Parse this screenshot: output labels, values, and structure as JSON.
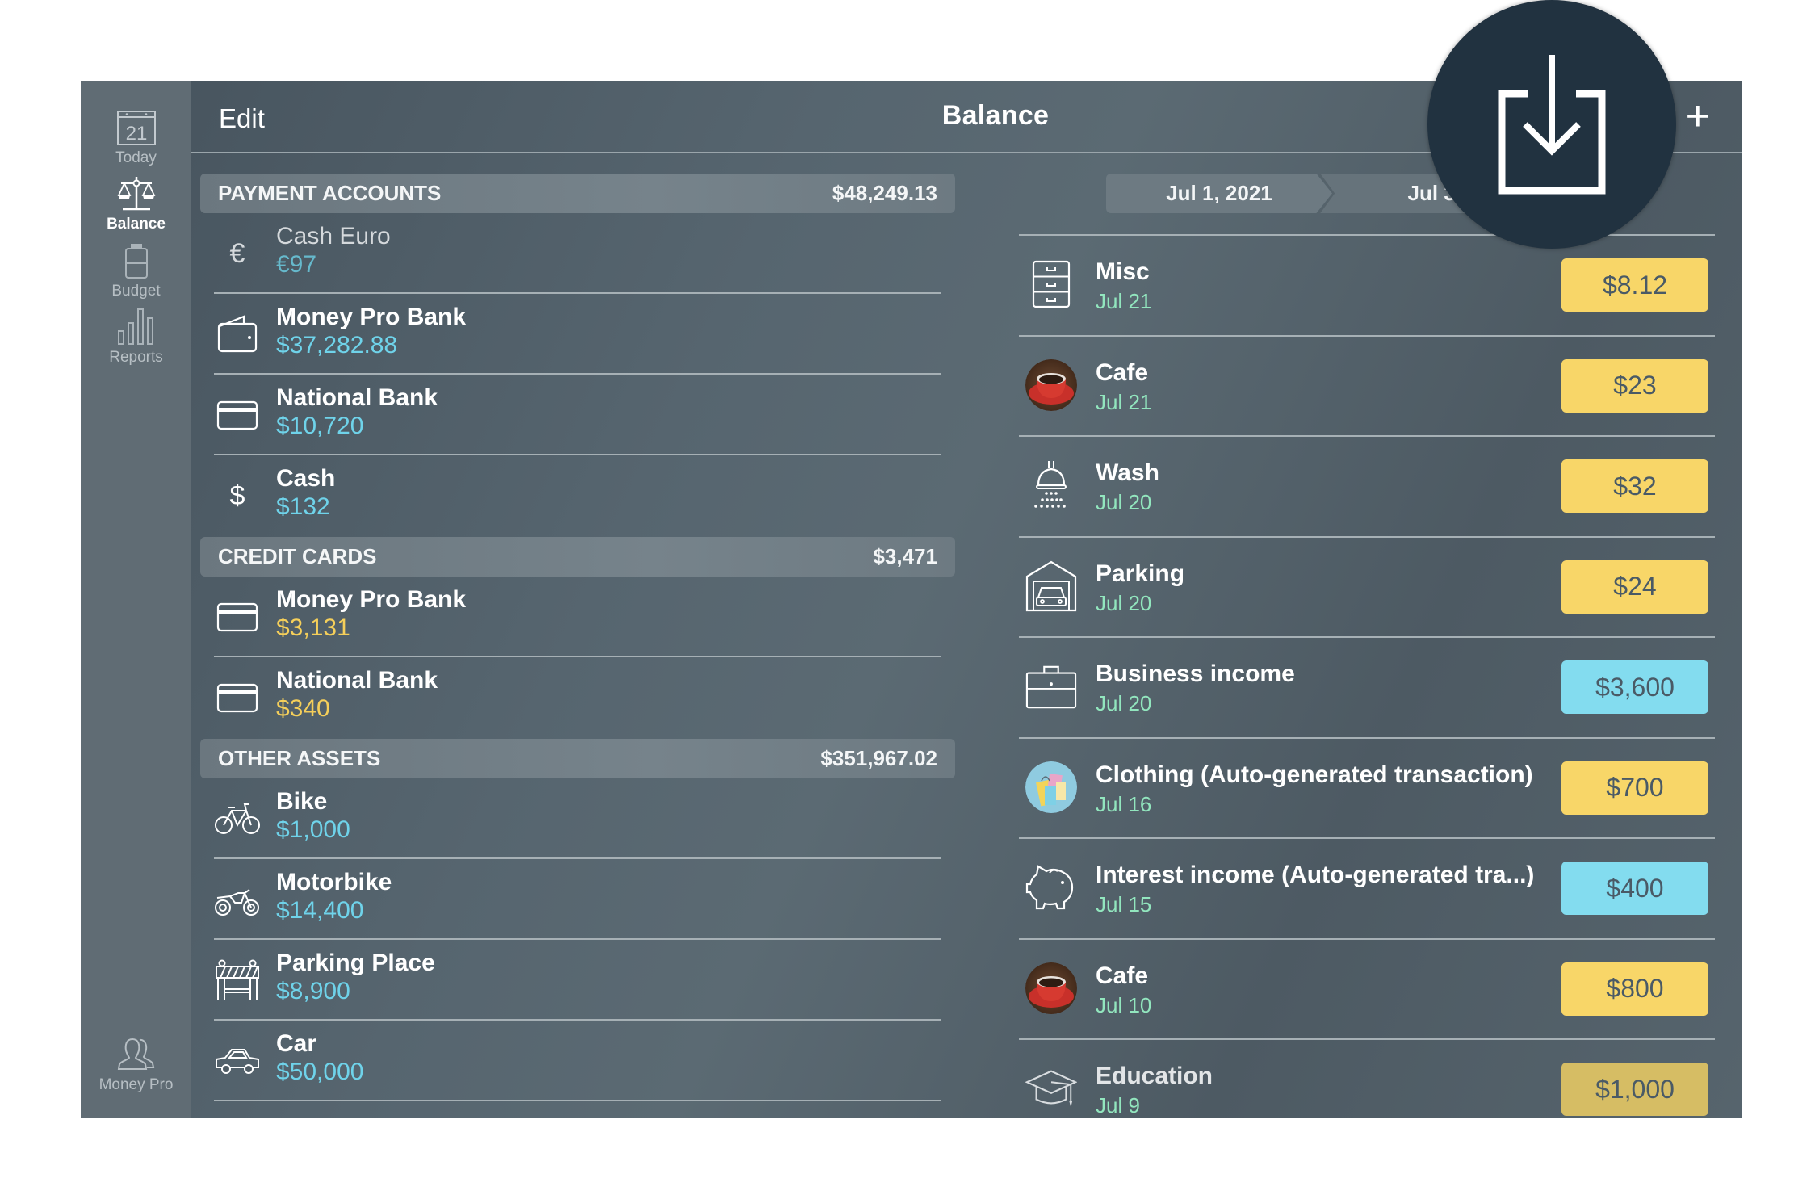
{
  "header": {
    "edit_label": "Edit",
    "title": "Balance",
    "add_label": "+"
  },
  "sidebar": {
    "items": [
      {
        "label": "Today",
        "icon": "calendar-icon",
        "calendar_day": "21",
        "active": false
      },
      {
        "label": "Balance",
        "icon": "scales-icon",
        "active": true
      },
      {
        "label": "Budget",
        "icon": "budget-jar-icon",
        "active": false
      },
      {
        "label": "Reports",
        "icon": "bar-chart-icon",
        "active": false
      }
    ],
    "footer": {
      "label": "Money Pro",
      "icon": "users-icon"
    }
  },
  "accounts": {
    "sections": [
      {
        "title": "PAYMENT ACCOUNTS",
        "total": "$48,249.13",
        "items": [
          {
            "name": "Cash Euro",
            "amount": "€97",
            "icon": "euro-icon",
            "color": "#6fd3ea"
          },
          {
            "name": "Money Pro Bank",
            "amount": "$37,282.88",
            "icon": "wallet-icon",
            "color": "#6fd3ea"
          },
          {
            "name": "National Bank",
            "amount": "$10,720",
            "icon": "credit-card-icon",
            "color": "#6fd3ea"
          },
          {
            "name": "Cash",
            "amount": "$132",
            "icon": "dollar-icon",
            "color": "#6fd3ea"
          }
        ]
      },
      {
        "title": "CREDIT CARDS",
        "total": "$3,471",
        "items": [
          {
            "name": "Money Pro Bank",
            "amount": "$3,131",
            "icon": "credit-card-icon",
            "color": "#f5cf5a"
          },
          {
            "name": "National Bank",
            "amount": "$340",
            "icon": "credit-card-icon",
            "color": "#f5cf5a"
          }
        ]
      },
      {
        "title": "OTHER ASSETS",
        "total": "$351,967.02",
        "items": [
          {
            "name": "Bike",
            "amount": "$1,000",
            "icon": "bicycle-icon",
            "color": "#6fd3ea"
          },
          {
            "name": "Motorbike",
            "amount": "$14,400",
            "icon": "motorbike-icon",
            "color": "#6fd3ea"
          },
          {
            "name": "Parking Place",
            "amount": "$8,900",
            "icon": "barrier-icon",
            "color": "#6fd3ea"
          },
          {
            "name": "Car",
            "amount": "$50,000",
            "icon": "car-icon",
            "color": "#6fd3ea"
          }
        ]
      }
    ]
  },
  "period": {
    "start": "Jul 1, 2021",
    "end": "Jul 31,"
  },
  "transactions": [
    {
      "name": "Misc",
      "date": "Jul 21",
      "amount": "$8.12",
      "type": "expense",
      "icon": "drawers-icon"
    },
    {
      "name": "Cafe",
      "date": "Jul 21",
      "amount": "$23",
      "type": "expense",
      "icon": "coffee-cup-icon"
    },
    {
      "name": "Wash",
      "date": "Jul 20",
      "amount": "$32",
      "type": "expense",
      "icon": "shower-icon"
    },
    {
      "name": "Parking",
      "date": "Jul 20",
      "amount": "$24",
      "type": "expense",
      "icon": "garage-icon"
    },
    {
      "name": "Business income",
      "date": "Jul 20",
      "amount": "$3,600",
      "type": "income",
      "icon": "briefcase-icon"
    },
    {
      "name": "Clothing (Auto-generated transaction)",
      "date": "Jul 16",
      "amount": "$700",
      "type": "expense",
      "icon": "shopping-bags-icon"
    },
    {
      "name": "Interest income (Auto-generated tra...)",
      "date": "Jul 15",
      "amount": "$400",
      "type": "income",
      "icon": "piggy-bank-icon"
    },
    {
      "name": "Cafe",
      "date": "Jul 10",
      "amount": "$800",
      "type": "expense",
      "icon": "coffee-cup-icon"
    },
    {
      "name": "Education",
      "date": "Jul 9",
      "amount": "$1,000",
      "type": "expense",
      "icon": "graduation-cap-icon"
    }
  ],
  "colors": {
    "expense_badge": "#f8d668",
    "income_badge": "#83dcef",
    "asset_amount": "#6fd3ea",
    "liability_amount": "#f5cf5a",
    "date_text": "#92e6be",
    "overlay_button": "#213240"
  },
  "overlay": {
    "icon": "import-download-icon"
  }
}
